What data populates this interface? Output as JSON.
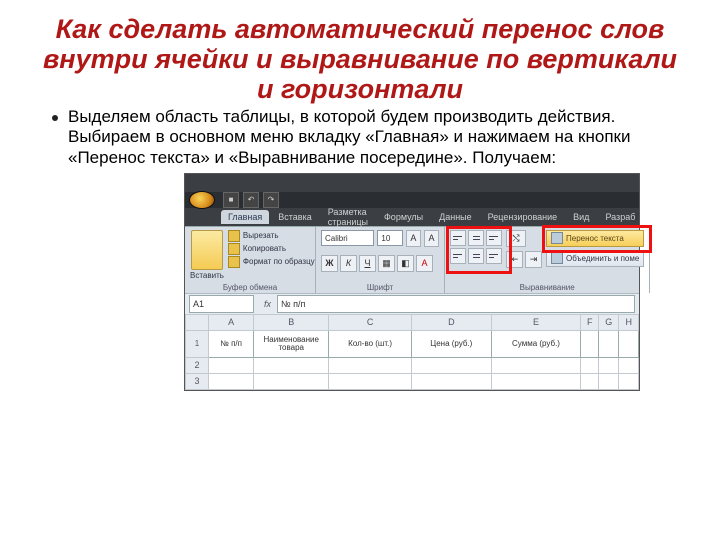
{
  "title": "Как сделать автоматический перенос слов внутри ячейки и выравнивание по вертикали и горизонтали",
  "body_text": "Выделяем область таблицы, в которой будем производить действия. Выбираем в основном меню вкладку «Главная» и нажимаем на кнопки «Перенос текста» и «Выравнивание посередине». Получаем:",
  "excel": {
    "tabs": [
      "Главная",
      "Вставка",
      "Разметка страницы",
      "Формулы",
      "Данные",
      "Рецензирование",
      "Вид",
      "Разраб"
    ],
    "clipboard": {
      "paste": "Вставить",
      "cut": "Вырезать",
      "copy": "Копировать",
      "format_painter": "Формат по образцу",
      "group": "Буфер обмена"
    },
    "font": {
      "name": "Calibri",
      "size": "10",
      "group": "Шрифт"
    },
    "alignment": {
      "wrap": "Перенос текста",
      "merge": "Объединить и поме",
      "group": "Выравнивание"
    },
    "namebox": "A1",
    "formula": "№ п/п",
    "columns": [
      "A",
      "B",
      "C",
      "D",
      "E",
      "F",
      "G",
      "H"
    ],
    "header_row": [
      "№ п/п",
      "Наименование товара",
      "Кол-во (шт.)",
      "Цена (руб.)",
      "Сумма (руб.)"
    ],
    "row_numbers": [
      "1",
      "2",
      "3"
    ]
  }
}
